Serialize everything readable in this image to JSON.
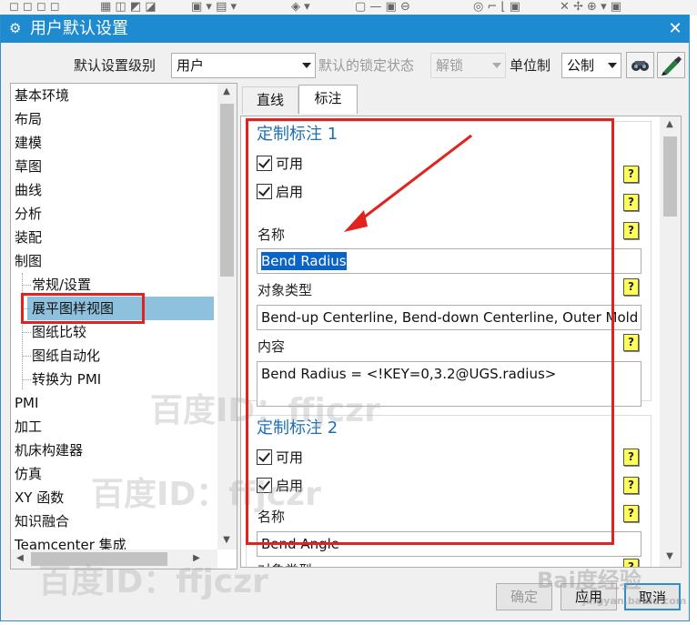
{
  "dialog": {
    "title": "用户默认设置",
    "close_glyph": "✕",
    "title_icon": "gear-icon"
  },
  "top_bar": {
    "level_label": "默认设置级别",
    "level_value": "用户",
    "lock_label": "默认的锁定状态",
    "lock_value": "解锁",
    "unit_label": "单位制",
    "unit_value": "公制",
    "icon_buttons": [
      "binoculars-icon",
      "pen-wizard-icon"
    ]
  },
  "tree": {
    "items": [
      {
        "label": "基本环境",
        "level": 0
      },
      {
        "label": "布局",
        "level": 0
      },
      {
        "label": "建模",
        "level": 0
      },
      {
        "label": "草图",
        "level": 0
      },
      {
        "label": "曲线",
        "level": 0
      },
      {
        "label": "分析",
        "level": 0
      },
      {
        "label": "装配",
        "level": 0
      },
      {
        "label": "制图",
        "level": 0
      },
      {
        "label": "常规/设置",
        "level": 1
      },
      {
        "label": "展平图样视图",
        "level": 1,
        "selected": true
      },
      {
        "label": "图纸比较",
        "level": 1
      },
      {
        "label": "图纸自动化",
        "level": 1
      },
      {
        "label": "转换为 PMI",
        "level": 1
      },
      {
        "label": "PMI",
        "level": 0
      },
      {
        "label": "加工",
        "level": 0
      },
      {
        "label": "机床构建器",
        "level": 0
      },
      {
        "label": "仿真",
        "level": 0
      },
      {
        "label": "XY 函数",
        "level": 0
      },
      {
        "label": "知识融合",
        "level": 0
      },
      {
        "label": "Teamcenter 集成",
        "level": 0
      }
    ]
  },
  "tabs": [
    {
      "label": "直线",
      "active": false
    },
    {
      "label": "标注",
      "active": true
    }
  ],
  "groups": [
    {
      "title": "定制标注 1",
      "usable_label": "可用",
      "enable_label": "启用",
      "name_label": "名称",
      "name_value": "Bend Radius",
      "type_label": "对象类型",
      "type_value": "Bend-up Centerline, Bend-down Centerline, Outer Mold Line",
      "content_label": "内容",
      "content_value": "Bend Radius = <!KEY=0,3.2@UGS.radius>"
    },
    {
      "title": "定制标注 2",
      "usable_label": "可用",
      "enable_label": "启用",
      "name_label": "名称",
      "name_value": "Bend Angle",
      "type_label": "对象类型"
    }
  ],
  "help_glyph": "?",
  "buttons": {
    "ok": "确定",
    "apply": "应用",
    "cancel": "取消"
  },
  "watermarks": {
    "w1": "百度ID：ffjczr",
    "w2": "百度ID：ffjczr",
    "w3": "百度ID：ffjczr",
    "baidu": "Bai度经验",
    "baidu_url": "jingyan.baidu.com"
  },
  "colors": {
    "title_bar": "#1e8ad0",
    "selection": "#8ec1de",
    "annotation_red": "#e0231f",
    "group_title": "#1e6fb5"
  }
}
